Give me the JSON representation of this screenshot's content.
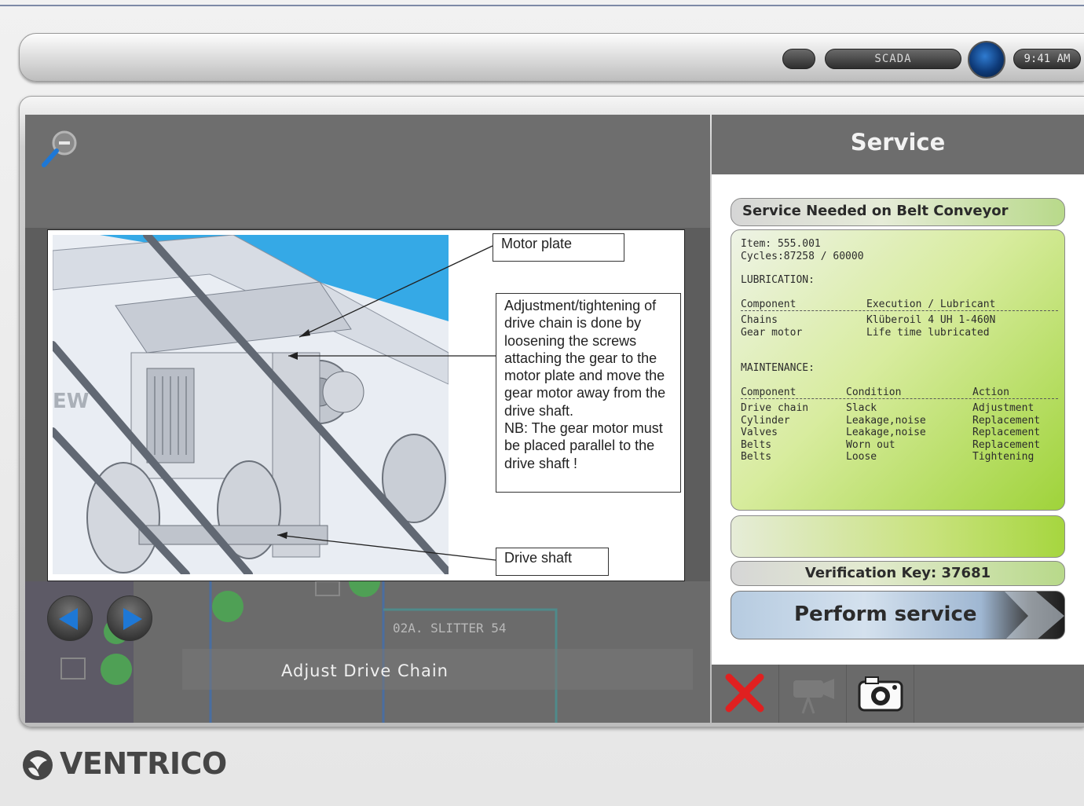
{
  "status": {
    "mode_label": "SCADA",
    "clock": "9:41 AM"
  },
  "viewer": {
    "callouts": {
      "motor_plate": "Motor plate",
      "adjustment": "Adjustment/tightening of drive chain is done by loosening the screws attaching the gear to the motor plate and move the gear motor away from the drive shaft.\nNB: The gear motor must be placed parallel to the drive shaft !",
      "drive_shaft": "Drive shaft"
    },
    "background_label": "02A. SLITTER 54",
    "step_caption": "Adjust Drive Chain"
  },
  "service": {
    "title": "Service",
    "needed_on": "Service Needed on Belt Conveyor",
    "item": "Item: 555.001",
    "cycles": "Cycles:87258 / 60000",
    "lubrication": {
      "heading": "LUBRICATION:",
      "columns": [
        "Component",
        "Execution / Lubricant"
      ],
      "rows": [
        [
          "Chains",
          "Klüberoil 4 UH 1-460N"
        ],
        [
          "Gear motor",
          "Life time lubricated"
        ]
      ]
    },
    "maintenance": {
      "heading": "MAINTENANCE:",
      "columns": [
        "Component",
        "Condition",
        "Action"
      ],
      "rows": [
        [
          "Drive chain",
          "Slack",
          "Adjustment"
        ],
        [
          "Cylinder",
          "Leakage,noise",
          "Replacement"
        ],
        [
          "Valves",
          "Leakage,noise",
          "Replacement"
        ],
        [
          "Belts",
          "Worn out",
          "Replacement"
        ],
        [
          "Belts",
          "Loose",
          "Tightening"
        ]
      ]
    },
    "verification": "Verification Key: 37681",
    "perform_label": "Perform service"
  },
  "icons": {
    "zoom": "zoom-out-icon",
    "prev": "arrow-left-icon",
    "next": "arrow-right-icon",
    "cancel": "close-icon",
    "video": "video-camera-icon",
    "photo": "camera-icon",
    "globe": "globe-icon"
  },
  "brand": {
    "name": "VENTRICO"
  },
  "colors": {
    "accent_green": "#9fd33a",
    "cancel_red": "#e02020",
    "perform_blue": "#b6cbe0",
    "arrow_blue": "#1e78d6"
  }
}
